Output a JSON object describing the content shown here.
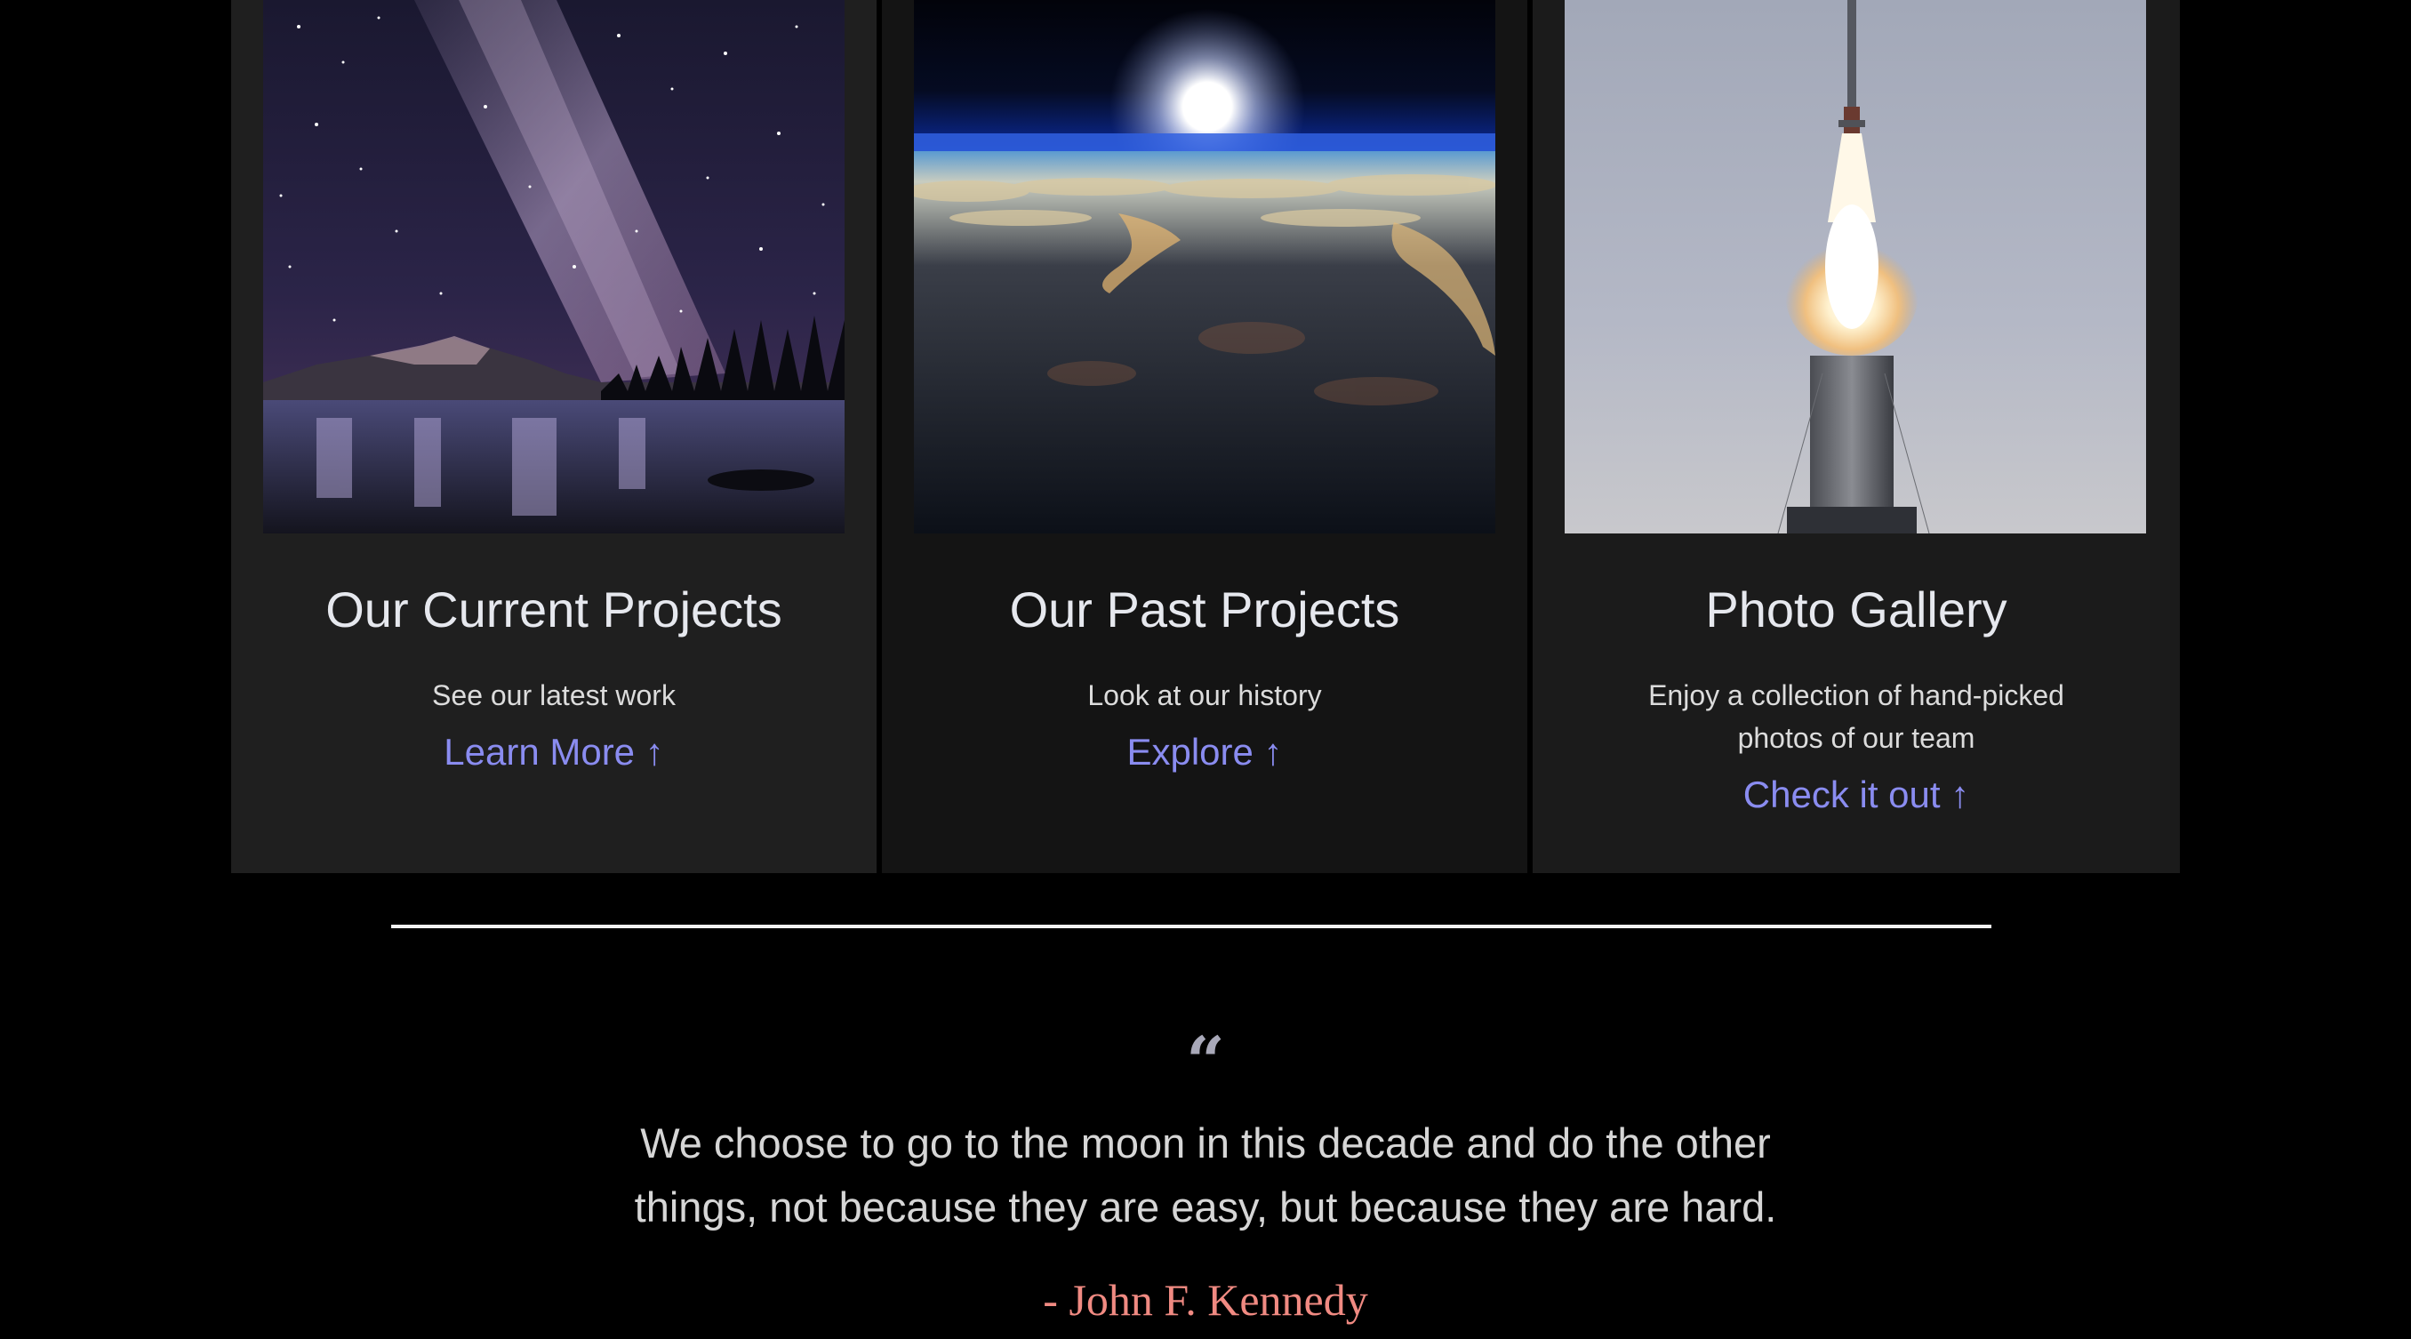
{
  "cards": [
    {
      "title": "Our Current Projects",
      "description": "See our latest work",
      "link": "Learn More ↑",
      "image": "milky-way-over-lake"
    },
    {
      "title": "Our Past Projects",
      "description": "Look at our history",
      "link": "Explore ↑",
      "image": "earth-from-orbit-sunrise"
    },
    {
      "title": "Photo Gallery",
      "description": "Enjoy a collection of hand-picked photos of our team",
      "link": "Check it out ↑",
      "image": "rocket-launch"
    }
  ],
  "quote": {
    "mark": "“",
    "text": "We choose to go to the moon in this decade and do the other things, not because they are easy, but because they are hard.",
    "author": "- John F. Kennedy"
  },
  "colors": {
    "background": "#000000",
    "link": "#8a8cf0",
    "author": "#f08a82",
    "divider": "#f2f2f2"
  }
}
